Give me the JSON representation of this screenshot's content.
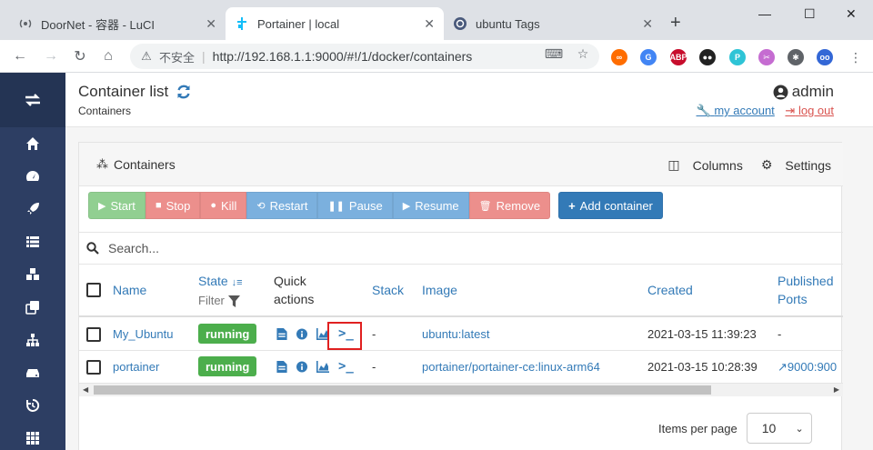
{
  "browser": {
    "tabs": [
      {
        "title": "DoorNet - 容器 - LuCI",
        "icon": "radio-icon",
        "active": false
      },
      {
        "title": "Portainer | local",
        "icon": "portainer-icon",
        "active": true
      },
      {
        "title": "ubuntu Tags",
        "icon": "ubuntu-icon",
        "active": false
      }
    ],
    "omnibox": {
      "security_label": "不安全",
      "url": "http://192.168.1.1:9000/#!/1/docker/containers"
    },
    "extensions": [
      {
        "name": "infinity-icon",
        "label": "∞",
        "color": "#ff6d00"
      },
      {
        "name": "translate-icon",
        "label": "G",
        "color": "#4285f4"
      },
      {
        "name": "adblock-icon",
        "label": "ABP",
        "color": "#c70d2c"
      },
      {
        "name": "tampermonkey-icon",
        "label": "●●",
        "color": "#222222"
      },
      {
        "name": "p-extension-icon",
        "label": "P",
        "color": "#2ec4d6"
      },
      {
        "name": "screenshot-icon",
        "label": "✂",
        "color": "#c56cd1"
      },
      {
        "name": "puzzle-icon",
        "label": "✱",
        "color": "#5f6368"
      },
      {
        "name": "profile-icon",
        "label": "oo",
        "color": "#3367d6"
      }
    ]
  },
  "header": {
    "title": "Container list",
    "subtitle": "Containers",
    "user": "admin",
    "my_account": "my account",
    "log_out": "log out"
  },
  "widget": {
    "title": "Containers",
    "columns_label": "Columns",
    "settings_label": "Settings"
  },
  "actions": {
    "start": "Start",
    "stop": "Stop",
    "kill": "Kill",
    "restart": "Restart",
    "pause": "Pause",
    "resume": "Resume",
    "remove": "Remove",
    "add": "Add container"
  },
  "search": {
    "placeholder": "Search..."
  },
  "table": {
    "headers": {
      "name": "Name",
      "state": "State",
      "state_sort_icon": "sort-amount-icon",
      "filter": "Filter",
      "quick_1": "Quick",
      "quick_2": "actions",
      "stack": "Stack",
      "image": "Image",
      "created": "Created",
      "published_1": "Published",
      "published_2": "Ports"
    },
    "rows": [
      {
        "name": "My_Ubuntu",
        "state": "running",
        "stack": "-",
        "image": "ubuntu:latest",
        "created": "2021-03-15 11:39:23",
        "ports": "-"
      },
      {
        "name": "portainer",
        "state": "running",
        "stack": "-",
        "image": "portainer/portainer-ce:linux-arm64",
        "created": "2021-03-15 10:28:39",
        "ports": "9000:900"
      }
    ]
  },
  "pager": {
    "label": "Items per page",
    "value": "10"
  },
  "colors": {
    "sidebar": "#2d3e63",
    "link": "#337ab7",
    "running": "#4cae4c",
    "highlight": "#e02020"
  }
}
